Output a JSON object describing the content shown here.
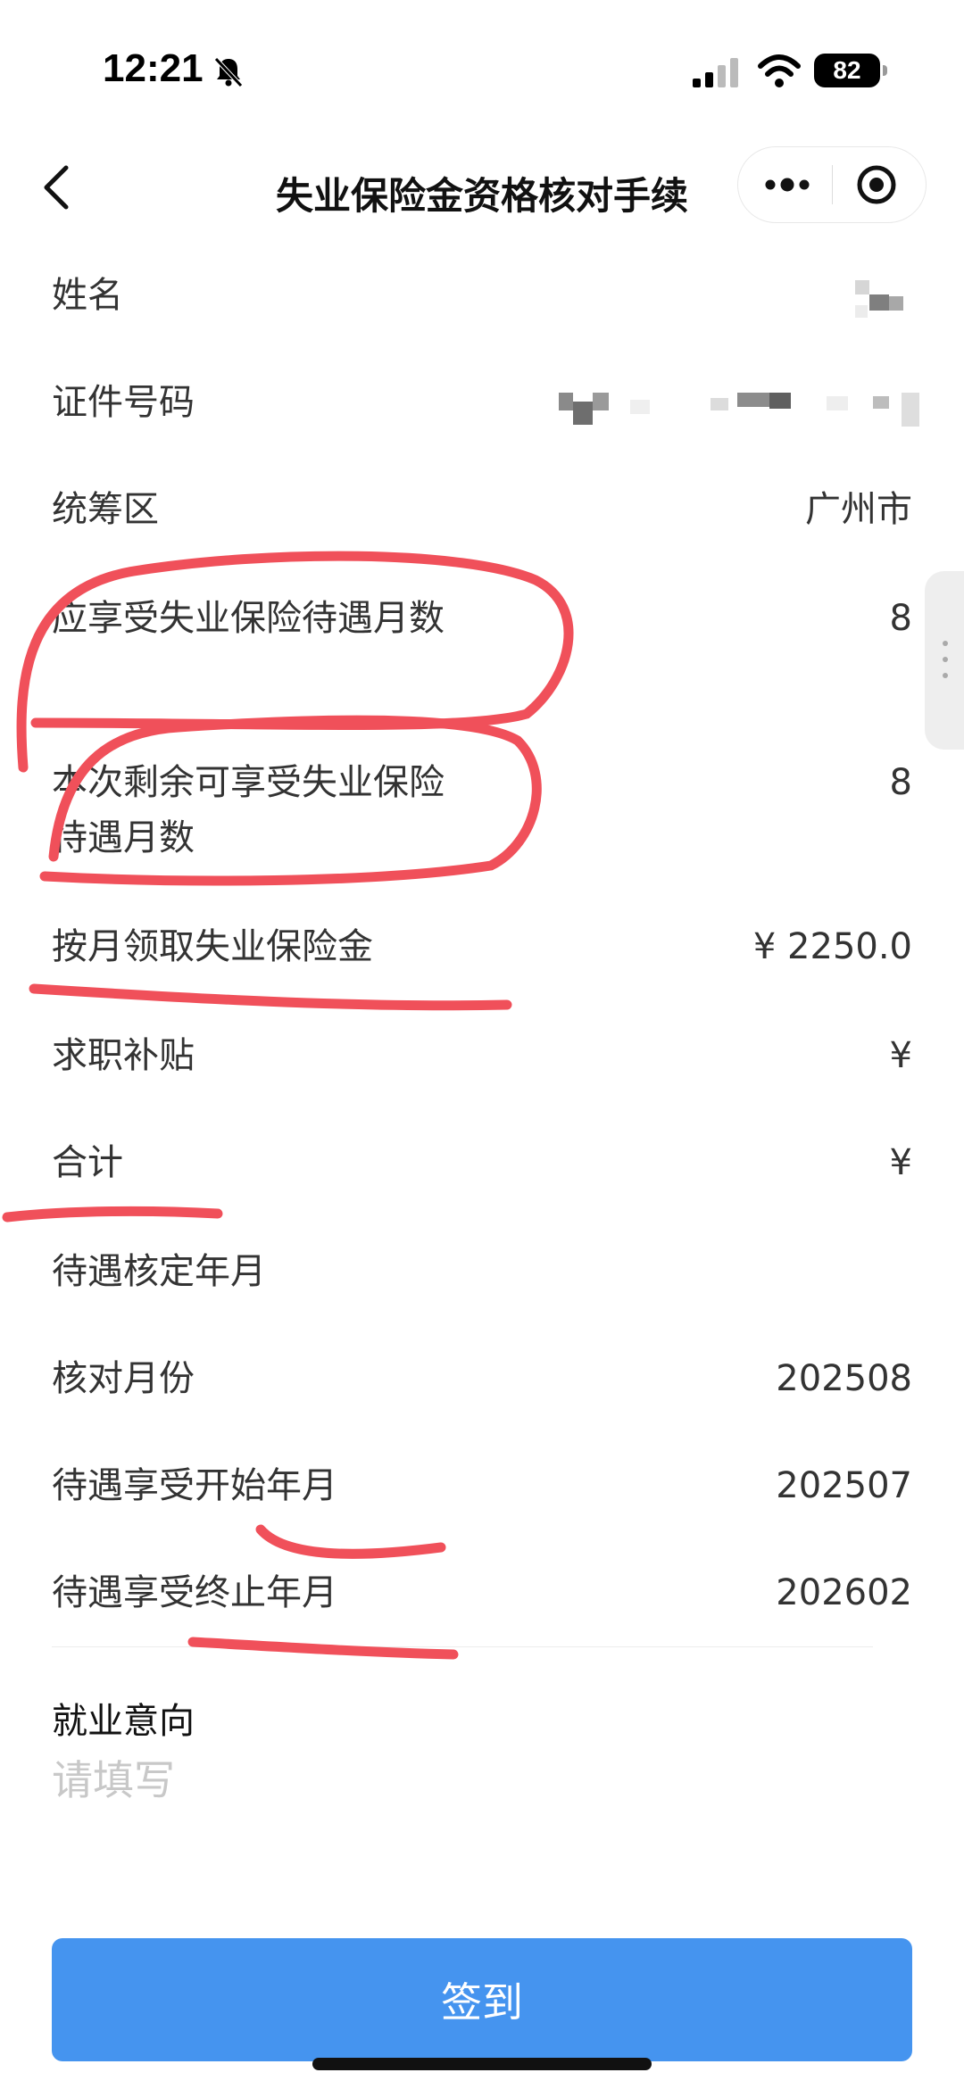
{
  "status_bar": {
    "time": "12:21",
    "battery": "82",
    "icons": [
      "bell-muted-icon",
      "signal-icon",
      "wifi-icon",
      "battery-icon"
    ]
  },
  "nav": {
    "title": "失业保险金资格核对手续",
    "icons": [
      "back-icon",
      "more-dots-icon",
      "target-icon"
    ]
  },
  "fields": {
    "name": {
      "label": "姓名",
      "value": ""
    },
    "id_number": {
      "label": "证件号码",
      "value": ""
    },
    "region": {
      "label": "统筹区",
      "value": "广州市"
    },
    "months_entitled": {
      "label": "应享受失业保险待遇月数",
      "value": "8"
    },
    "months_remaining": {
      "label": "本次剩余可享受失业保险待遇月数",
      "value": "8"
    },
    "monthly_benefit": {
      "label": "按月领取失业保险金",
      "value": "¥ 2250.0"
    },
    "job_subsidy": {
      "label": "求职补贴",
      "value": "¥"
    },
    "total": {
      "label": "合计",
      "value": "¥"
    },
    "approval_month": {
      "label": "待遇核定年月",
      "value": ""
    },
    "check_month": {
      "label": "核对月份",
      "value": "202508"
    },
    "start_month": {
      "label": "待遇享受开始年月",
      "value": "202507"
    },
    "end_month": {
      "label": "待遇享受终止年月",
      "value": "202602"
    }
  },
  "intent": {
    "label": "就业意向",
    "placeholder": "请填写",
    "value": ""
  },
  "button": {
    "label": "签到"
  },
  "colors": {
    "primary": "#4594ef",
    "annotation": "#f0505a",
    "text": "#333333",
    "placeholder": "#c8c8c8"
  }
}
